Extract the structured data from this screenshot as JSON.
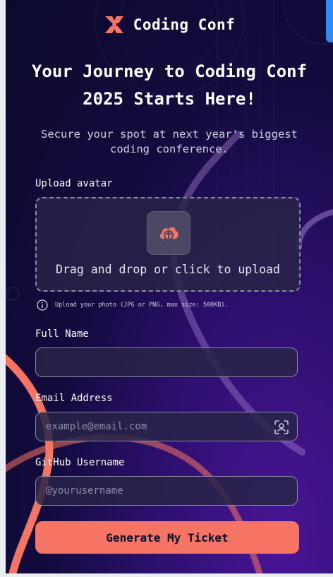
{
  "header": {
    "app_name": "Coding Conf",
    "logo_icon": "coding-conf-logo"
  },
  "hero": {
    "title": "Your Journey to Coding Conf 2025 Starts Here!",
    "subtitle": "Secure your spot at next year's biggest coding conference."
  },
  "form": {
    "avatar": {
      "label": "Upload avatar",
      "dropzone_text": "Drag and drop or click to upload",
      "icon": "cloud-upload-icon",
      "hint": "Upload your photo (JPG or PNG, max size: 500KB).",
      "hint_icon": "info-icon"
    },
    "full_name": {
      "label": "Full Name",
      "value": "",
      "placeholder": ""
    },
    "email": {
      "label": "Email Address",
      "value": "",
      "placeholder": "example@email.com",
      "icon": "contact-icon"
    },
    "github": {
      "label": "GitHub Username",
      "value": "",
      "placeholder": "@yourusername"
    },
    "submit_label": "Generate My Ticket"
  },
  "colors": {
    "accent": "#f57463",
    "background_dark": "#0b0a2c",
    "background_purple": "#4a1598",
    "input_bg": "#282448",
    "input_border": "#8b89a8",
    "scroll_tab": "#2f8df0"
  }
}
